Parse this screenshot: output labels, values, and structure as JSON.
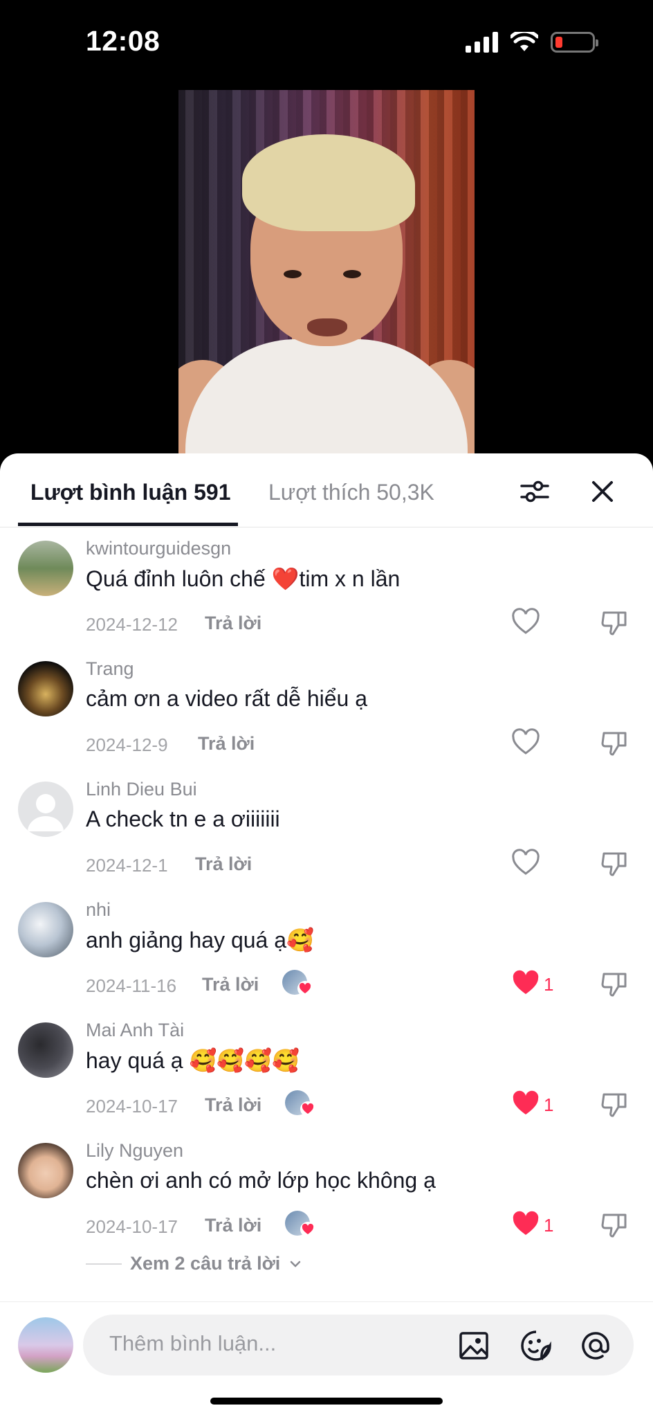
{
  "status_bar": {
    "time": "12:08"
  },
  "tabs": {
    "comments_label": "Lượt bình luận 591",
    "likes_label": "Lượt thích 50,3K"
  },
  "comments": [
    {
      "username": "kwintourguidesgn",
      "text": "Quá đỉnh luôn chế ❤️tim x n lần",
      "date": "2024-12-12",
      "reply": "Trả lời",
      "liked_by_creator": false,
      "likes": ""
    },
    {
      "username": "Trang",
      "text": "cảm ơn a video rất dễ hiểu ạ",
      "date": "2024-12-9",
      "reply": "Trả lời",
      "liked_by_creator": false,
      "likes": ""
    },
    {
      "username": "Linh Dieu Bui",
      "text": "A check tn e a ơiiiiiii",
      "date": "2024-12-1",
      "reply": "Trả lời",
      "liked_by_creator": false,
      "likes": ""
    },
    {
      "username": "nhi",
      "text": "anh giảng hay quá ạ🥰",
      "date": "2024-11-16",
      "reply": "Trả lời",
      "liked_by_creator": true,
      "likes": "1"
    },
    {
      "username": "Mai Anh Tài",
      "text": "hay quá ạ 🥰🥰🥰🥰",
      "date": "2024-10-17",
      "reply": "Trả lời",
      "liked_by_creator": true,
      "likes": "1"
    },
    {
      "username": "Lily Nguyen",
      "text": "chèn ơi anh có mở lớp học không ạ",
      "date": "2024-10-17",
      "reply": "Trả lời",
      "liked_by_creator": true,
      "likes": "1"
    }
  ],
  "view_replies": "Xem 2 câu trả lời",
  "input": {
    "placeholder": "Thêm bình luận..."
  },
  "colors": {
    "accent": "#fe2c55",
    "text": "#161823",
    "muted": "#8a8b91"
  }
}
